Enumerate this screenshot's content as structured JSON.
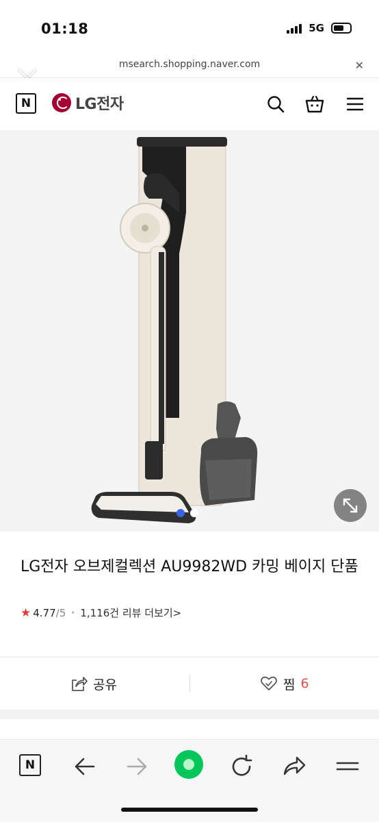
{
  "status_bar": {
    "time": "01:18",
    "network": "5G"
  },
  "url_bar": {
    "url": "msearch.shopping.naver.com",
    "close_glyph": "✕"
  },
  "header": {
    "naver_logo": "N",
    "brand_name": "LG전자",
    "icons": [
      "search-icon",
      "cart-icon",
      "menu-icon"
    ]
  },
  "hero": {
    "image_count": 2,
    "active_image_index": 0
  },
  "product": {
    "title": "LG전자 오브제컬렉션 AU9982WD 카밍 베이지 단품",
    "rating_star": "★",
    "rating": "4.77",
    "rating_max": "/5",
    "separator": "•",
    "review_link": "1,116건 리뷰 더보기>"
  },
  "actions": {
    "share_label": "공유",
    "wish_label": "찜",
    "wish_count": "6"
  },
  "toolbar": {
    "naver_button": "N",
    "items": [
      "naver-home-icon",
      "back-arrow-icon",
      "forward-arrow-icon",
      "green-dot-icon",
      "refresh-icon",
      "share-arrow-icon",
      "menu-icon"
    ]
  },
  "colors": {
    "lg_red": "#a50034",
    "rating_star": "#e33a3a",
    "wish_count": "#e05050",
    "pager_active": "#3b63e6",
    "naver_green": "#03c75a"
  }
}
